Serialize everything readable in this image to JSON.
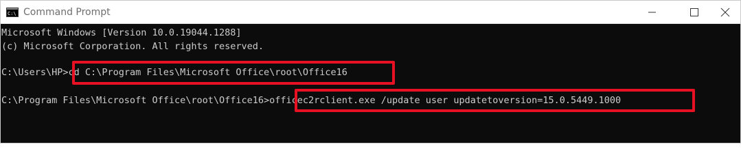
{
  "window": {
    "title": "Command Prompt",
    "icon": "cmd-icon",
    "controls": [
      "minimize-icon",
      "maximize-icon",
      "close-icon"
    ]
  },
  "console": {
    "lines": [
      {
        "text": "Microsoft Windows [Version 10.0.19044.1288]"
      },
      {
        "text": "(c) Microsoft Corporation. All rights reserved."
      },
      {
        "prompt": "C:\\Users\\HP>",
        "command": "cd C:\\Program Files\\Microsoft Office\\root\\Office16"
      },
      {
        "prompt": "C:\\Program Files\\Microsoft Office\\root\\Office16>",
        "command": "officec2rclient.exe /update user updatetoversion=15.0.5449.1000"
      }
    ]
  },
  "colors": {
    "console_bg": "#0c0c0c",
    "console_text": "#cccccc",
    "highlight": "#e81123"
  }
}
